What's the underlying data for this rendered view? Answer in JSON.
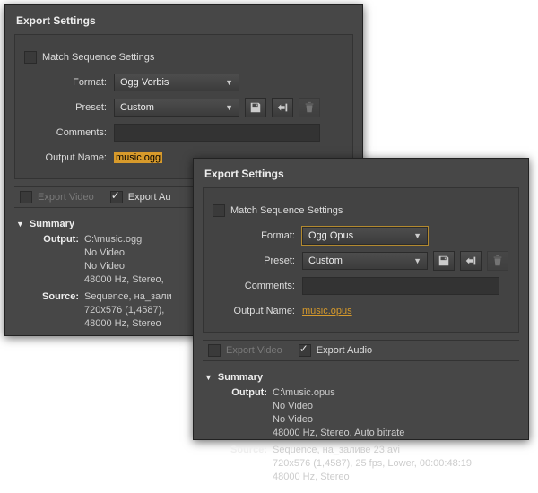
{
  "panel1": {
    "title": "Export Settings",
    "match_label": "Match Sequence Settings",
    "format_label": "Format:",
    "format_value": "Ogg Vorbis",
    "preset_label": "Preset:",
    "preset_value": "Custom",
    "comments_label": "Comments:",
    "outputname_label": "Output Name:",
    "outputname_value": "music.ogg",
    "export_video_label": "Export Video",
    "export_audio_label": "Export Au",
    "summary_label": "Summary",
    "output_key": "Output:",
    "output_l1": "C:\\music.ogg",
    "output_l2": "No Video",
    "output_l3": "No Video",
    "output_l4": "48000 Hz, Stereo,",
    "source_key": "Source:",
    "source_l1": "Sequence, на_зали",
    "source_l2": "720x576 (1,4587),",
    "source_l3": "48000 Hz, Stereo"
  },
  "panel2": {
    "title": "Export Settings",
    "match_label": "Match Sequence Settings",
    "format_label": "Format:",
    "format_value": "Ogg Opus",
    "preset_label": "Preset:",
    "preset_value": "Custom",
    "comments_label": "Comments:",
    "outputname_label": "Output Name:",
    "outputname_value": "music.opus",
    "export_video_label": "Export Video",
    "export_audio_label": "Export Audio",
    "summary_label": "Summary",
    "output_key": "Output:",
    "output_l1": "C:\\music.opus",
    "output_l2": "No Video",
    "output_l3": "No Video",
    "output_l4": "48000 Hz, Stereo, Auto bitrate",
    "source_key": "Source:",
    "source_l1": "Sequence, на_заливе 23.avi",
    "source_l2": "720x576 (1,4587), 25 fps, Lower, 00:00:48:19",
    "source_l3": "48000 Hz, Stereo"
  }
}
